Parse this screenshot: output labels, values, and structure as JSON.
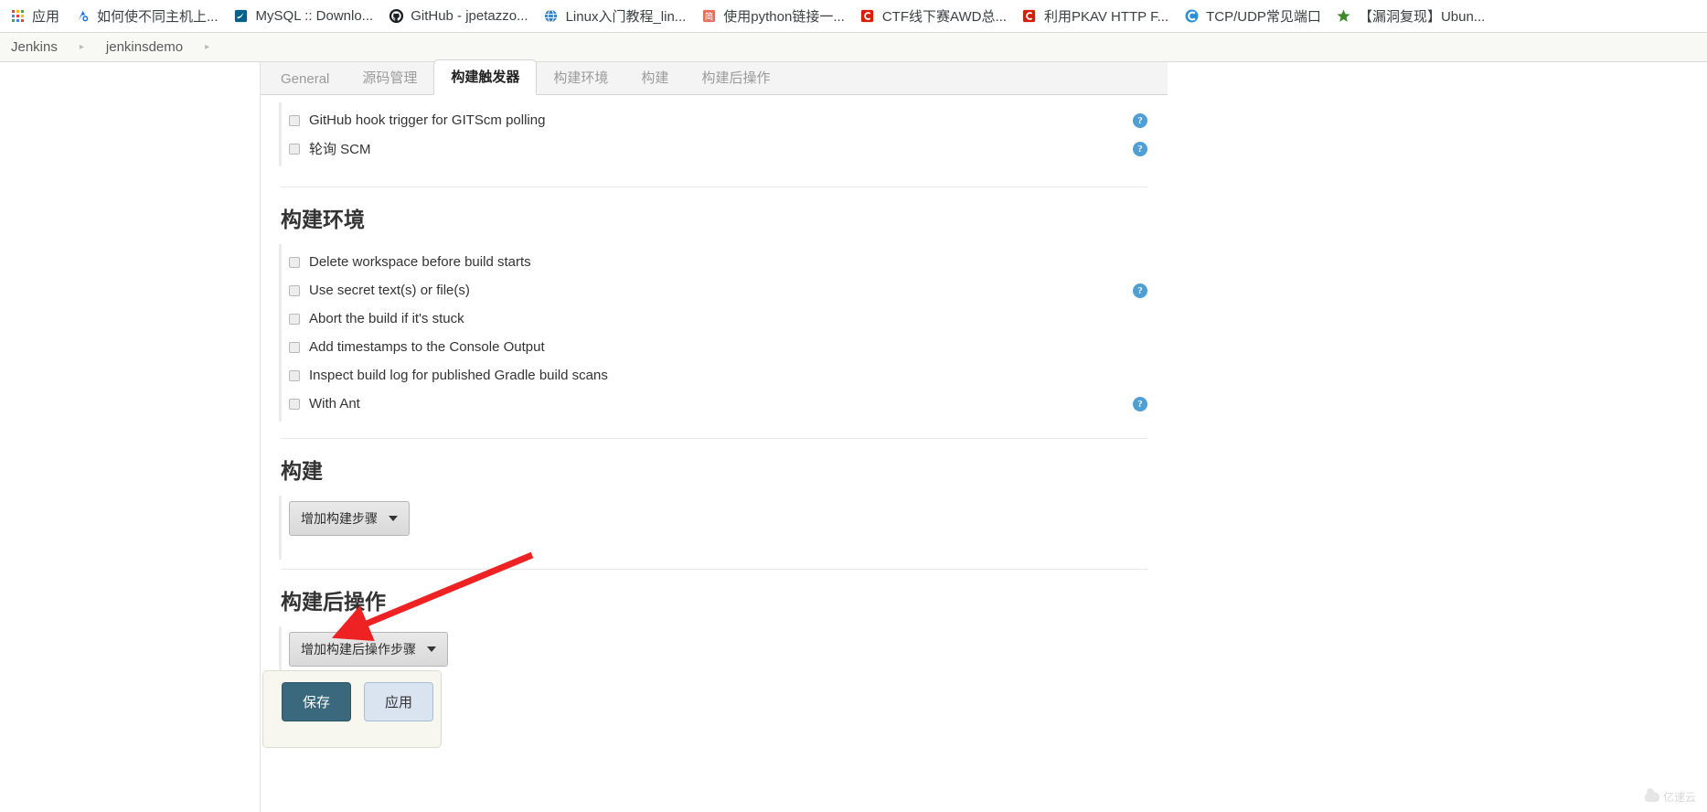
{
  "browser": {
    "bookmarks": [
      {
        "label": "应用",
        "icon": "apps-grid-icon"
      },
      {
        "label": "如何使不同主机上...",
        "icon": "bookmark-site-icon"
      },
      {
        "label": "MySQL :: Downlo...",
        "icon": "mysql-dolphin-icon"
      },
      {
        "label": "GitHub - jpetazzo...",
        "icon": "github-icon"
      },
      {
        "label": "Linux入门教程_lin...",
        "icon": "globe-icon"
      },
      {
        "label": "使用python链接一...",
        "icon": "jianshu-icon"
      },
      {
        "label": "CTF线下赛AWD总...",
        "icon": "csdn-icon"
      },
      {
        "label": "利用PKAV HTTP F...",
        "icon": "csdn-icon"
      },
      {
        "label": "TCP/UDP常见端口",
        "icon": "cnblogs-icon"
      },
      {
        "label": "【漏洞复现】Ubun...",
        "icon": "star-icon"
      }
    ]
  },
  "breadcrumb": {
    "items": [
      "Jenkins",
      "jenkinsdemo"
    ],
    "separator": "▸"
  },
  "tabs": [
    {
      "label": "General",
      "active": false
    },
    {
      "label": "源码管理",
      "active": false
    },
    {
      "label": "构建触发器",
      "active": true
    },
    {
      "label": "构建环境",
      "active": false
    },
    {
      "label": "构建",
      "active": false
    },
    {
      "label": "构建后操作",
      "active": false
    }
  ],
  "triggers": {
    "options": [
      {
        "label": "GitHub hook trigger for GITScm polling",
        "checked": false,
        "help": true
      },
      {
        "label": "轮询 SCM",
        "checked": false,
        "help": true
      }
    ]
  },
  "build_environment": {
    "title": "构建环境",
    "options": [
      {
        "label": "Delete workspace before build starts",
        "checked": false,
        "help": false
      },
      {
        "label": "Use secret text(s) or file(s)",
        "checked": false,
        "help": true
      },
      {
        "label": "Abort the build if it's stuck",
        "checked": false,
        "help": false
      },
      {
        "label": "Add timestamps to the Console Output",
        "checked": false,
        "help": false
      },
      {
        "label": "Inspect build log for published Gradle build scans",
        "checked": false,
        "help": false
      },
      {
        "label": "With Ant",
        "checked": false,
        "help": true
      }
    ]
  },
  "build": {
    "title": "构建",
    "add_step_button": "增加构建步骤"
  },
  "post_build": {
    "title": "构建后操作",
    "add_step_button": "增加构建后操作步骤"
  },
  "actions": {
    "save_label": "保存",
    "apply_label": "应用"
  },
  "annotation": {
    "arrow_color": "#ee2222",
    "points_to": "保存"
  },
  "watermark": {
    "text": "亿速云"
  },
  "colors": {
    "save_button": "#3a697d",
    "apply_button": "#dae4f0",
    "help_icon": "#4f9fd4",
    "tab_active_text": "#1f1f1f",
    "tab_inactive_text": "#9a9a9a"
  }
}
